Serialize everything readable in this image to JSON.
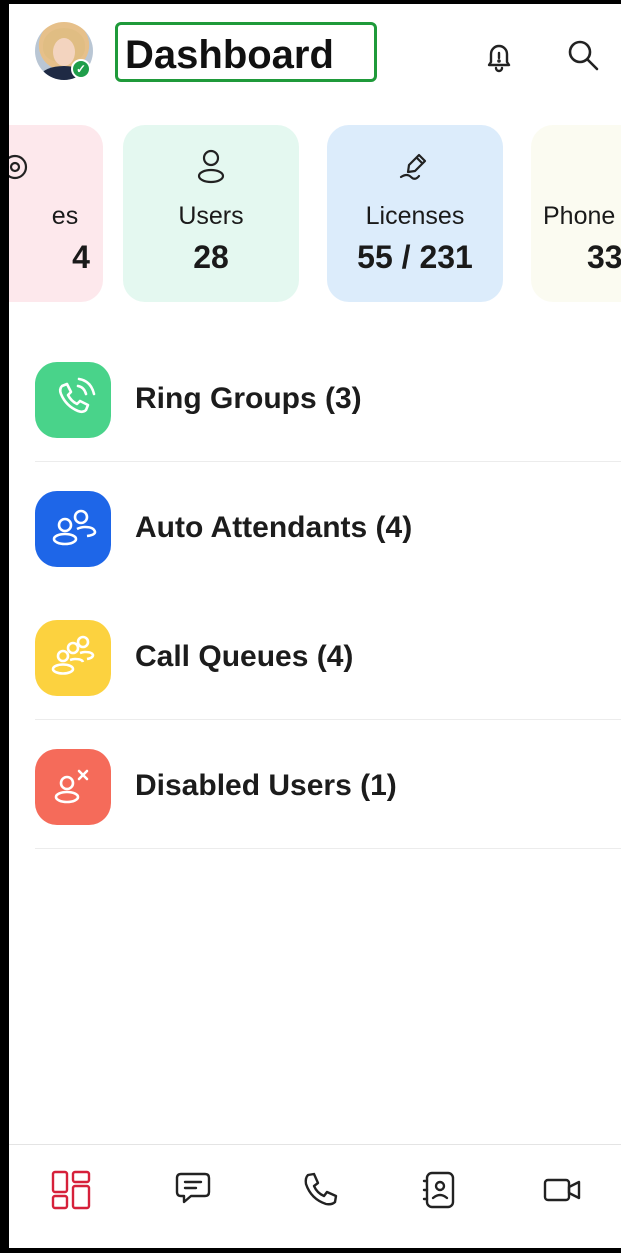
{
  "header": {
    "title": "Dashboard",
    "avatar_status": "online"
  },
  "stats": {
    "devices": {
      "label": "es",
      "value": "4",
      "icon": "eye-icon",
      "color": "#fde8ec"
    },
    "users": {
      "label": "Users",
      "value": "28",
      "icon": "user-icon",
      "color": "#e4f8f0"
    },
    "licenses": {
      "label": "Licenses",
      "value": "55 / 231",
      "icon": "pen-icon",
      "color": "#dcecfb"
    },
    "phones": {
      "label": "Phone",
      "value": "33",
      "icon": "phone-icon",
      "color": "#fbfbf1"
    }
  },
  "list": [
    {
      "label": "Ring Groups (3)",
      "icon": "phone-ring-icon",
      "color": "#49d38a"
    },
    {
      "label": "Auto Attendants (4)",
      "icon": "users-icon",
      "color": "#1e66e8"
    },
    {
      "label": "Call Queues (4)",
      "icon": "queue-users-icon",
      "color": "#fcd23f"
    },
    {
      "label": "Disabled Users (1)",
      "icon": "user-x-icon",
      "color": "#f56b5a"
    }
  ],
  "nav": [
    {
      "icon": "dashboard-icon",
      "active": true,
      "accent": "#d6203a"
    },
    {
      "icon": "chat-icon",
      "active": false
    },
    {
      "icon": "phone-icon",
      "active": false
    },
    {
      "icon": "contacts-icon",
      "active": false
    },
    {
      "icon": "video-icon",
      "active": false
    }
  ]
}
